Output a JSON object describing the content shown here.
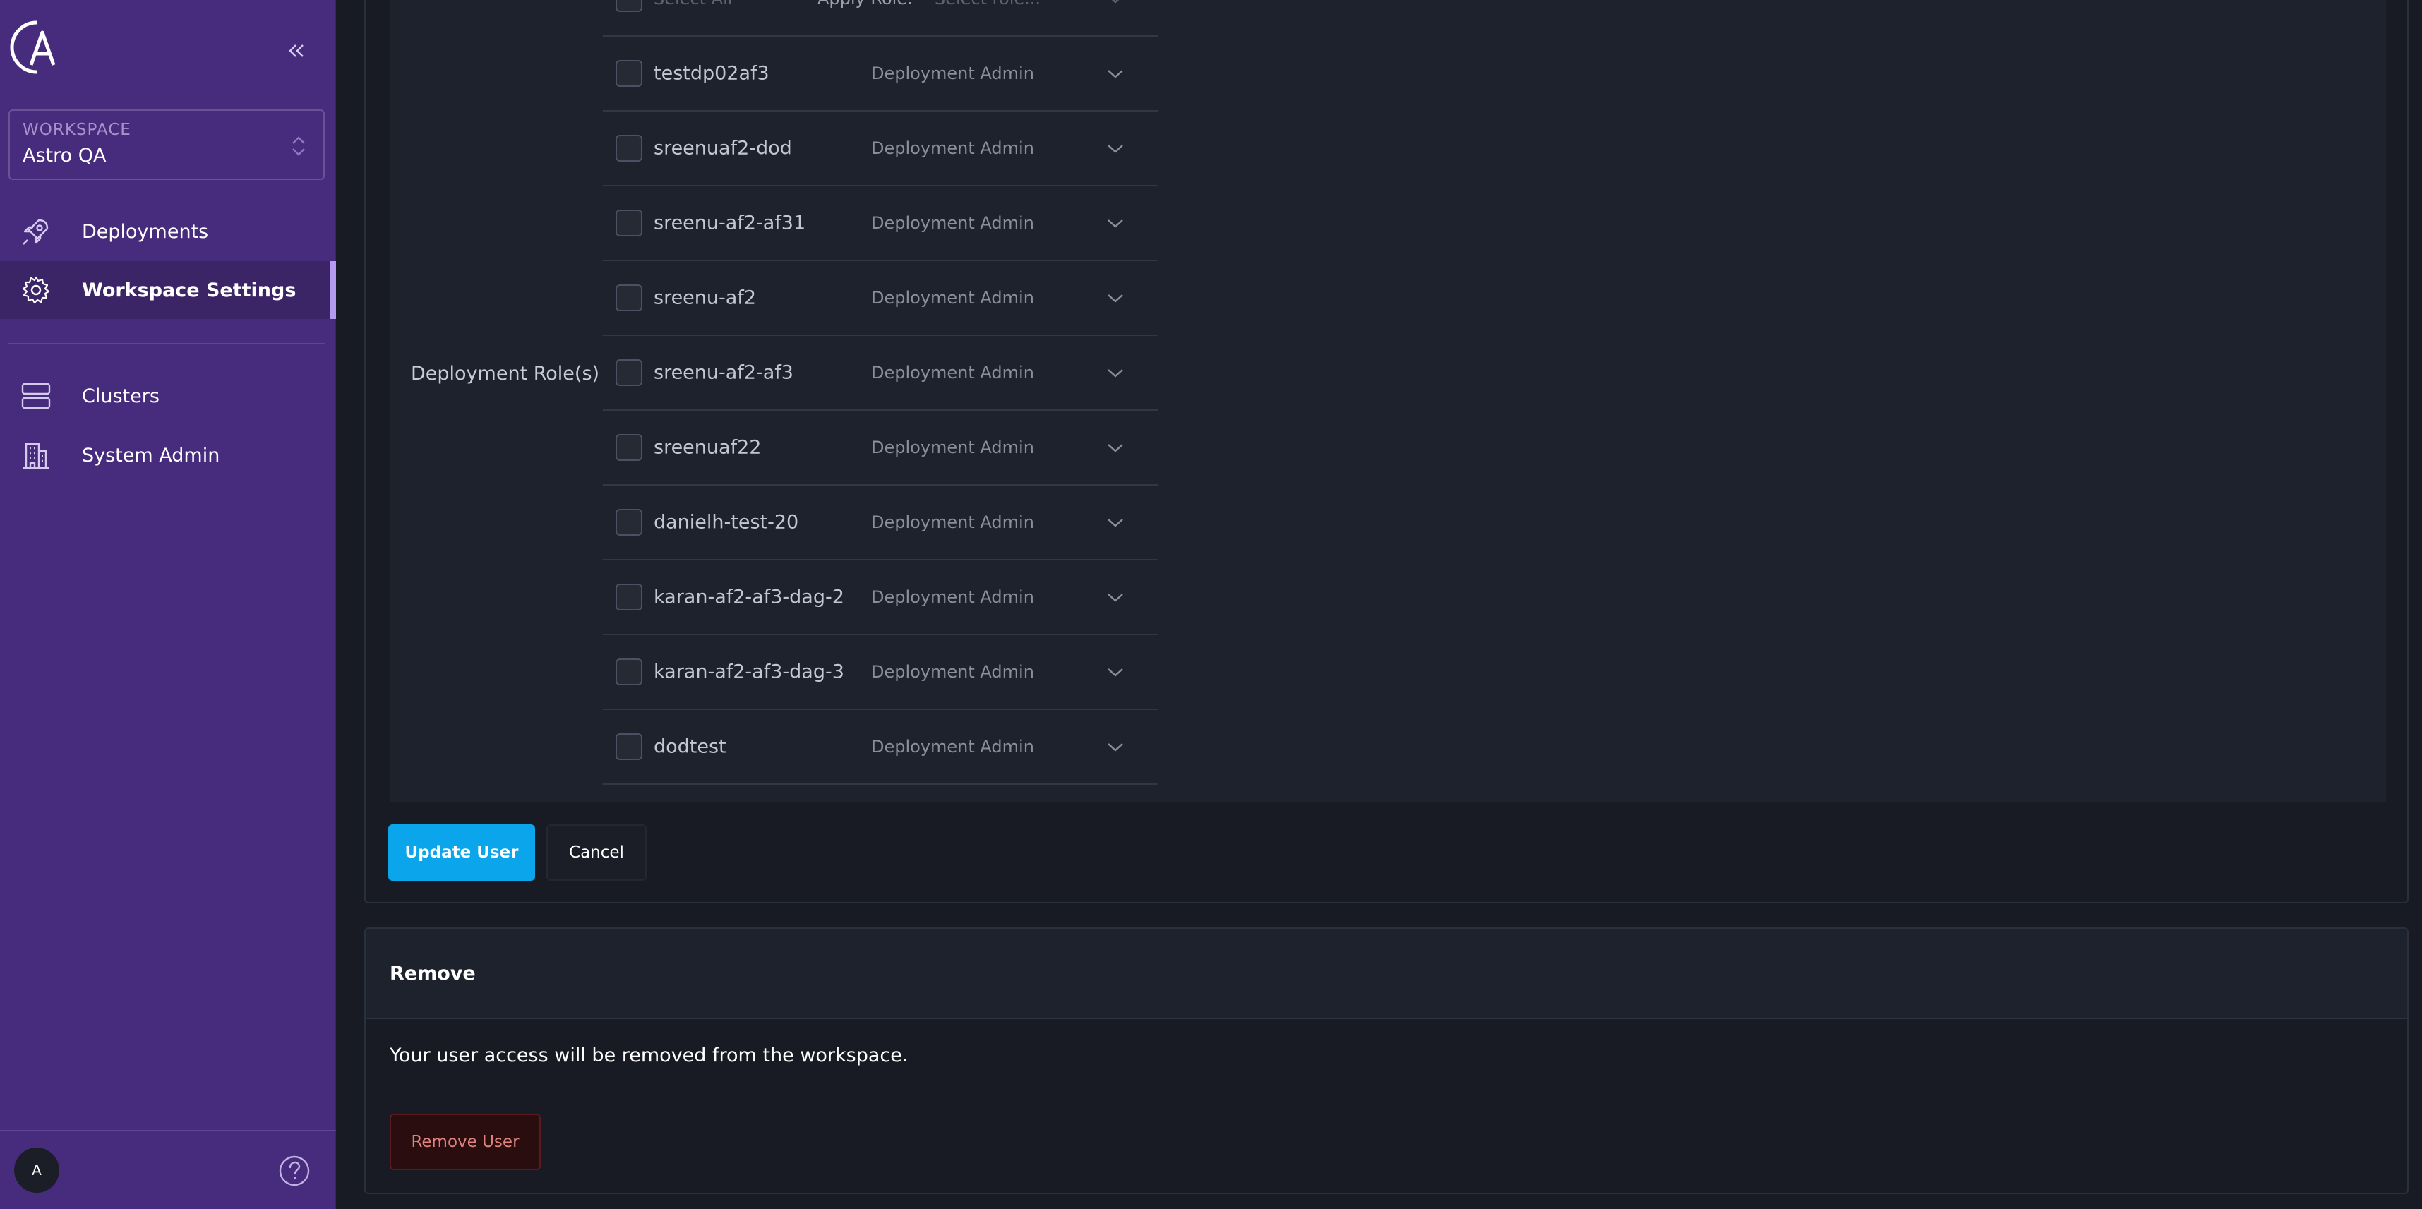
{
  "sidebar": {
    "collapse_icon": "double-chevron-left-icon",
    "workspace": {
      "caption": "WORKSPACE",
      "name": "Astro QA"
    },
    "nav": [
      {
        "label": "Deployments",
        "icon": "rocket-icon",
        "active": false
      },
      {
        "label": "Workspace Settings",
        "icon": "gear-icon",
        "active": true
      },
      {
        "label": "Clusters",
        "icon": "server-stack-icon",
        "active": false
      },
      {
        "label": "System Admin",
        "icon": "building-icon",
        "active": false
      }
    ],
    "avatar_initial": "A",
    "help_icon": "question-circle-icon"
  },
  "roles": {
    "section_label": "Deployment Role(s)",
    "header": {
      "select_all": "Select All",
      "apply_role": "Apply Role:",
      "select_placeholder": "Select role..."
    },
    "deployments": [
      {
        "name": "testdp02af3",
        "role": "Deployment Admin"
      },
      {
        "name": "sreenuaf2-dod",
        "role": "Deployment Admin"
      },
      {
        "name": "sreenu-af2-af31",
        "role": "Deployment Admin"
      },
      {
        "name": "sreenu-af2",
        "role": "Deployment Admin"
      },
      {
        "name": "sreenu-af2-af3",
        "role": "Deployment Admin"
      },
      {
        "name": "sreenuaf22",
        "role": "Deployment Admin"
      },
      {
        "name": "danielh-test-20",
        "role": "Deployment Admin"
      },
      {
        "name": "karan-af2-af3-dag-2",
        "role": "Deployment Admin"
      },
      {
        "name": "karan-af2-af3-dag-3",
        "role": "Deployment Admin"
      },
      {
        "name": "dodtest",
        "role": "Deployment Admin"
      }
    ]
  },
  "actions": {
    "update_label": "Update User",
    "cancel_label": "Cancel"
  },
  "remove": {
    "title": "Remove",
    "description": "Your user access will be removed from the workspace.",
    "button_label": "Remove User"
  },
  "colors": {
    "sidebar_bg": "#472c7d",
    "content_bg": "#181b24",
    "primary_button": "#0aa5ea",
    "danger_button_bg": "#2a0d0f",
    "danger_text": "#e0837f"
  }
}
